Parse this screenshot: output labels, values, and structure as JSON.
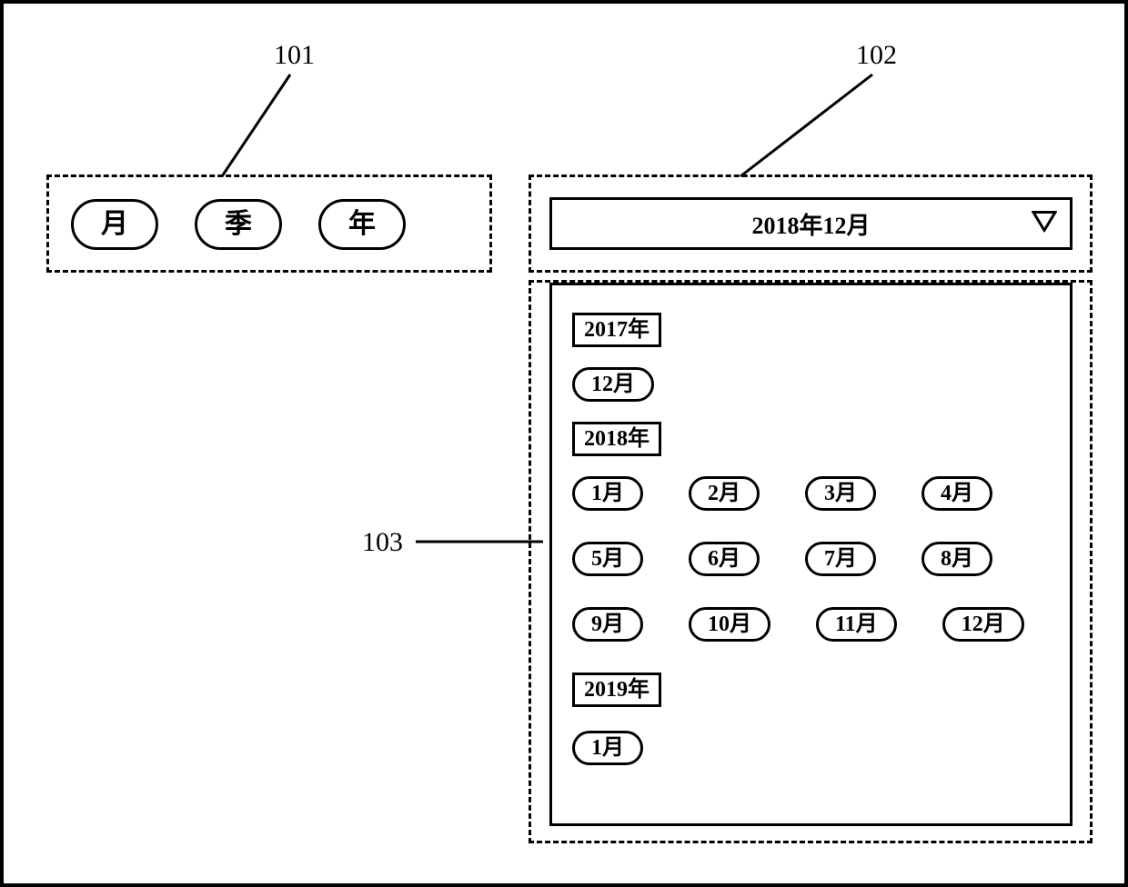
{
  "callouts": {
    "a": "101",
    "b": "102",
    "c": "103"
  },
  "selector": {
    "month": "月",
    "quarter": "季",
    "year": "年"
  },
  "dropdown": {
    "value": "2018年12月"
  },
  "list": {
    "y2017": {
      "label": "2017年",
      "months": [
        "12月"
      ]
    },
    "y2018": {
      "label": "2018年",
      "months": [
        "1月",
        "2月",
        "3月",
        "4月",
        "5月",
        "6月",
        "7月",
        "8月",
        "9月",
        "10月",
        "11月",
        "12月"
      ]
    },
    "y2019": {
      "label": "2019年",
      "months": [
        "1月"
      ]
    }
  }
}
